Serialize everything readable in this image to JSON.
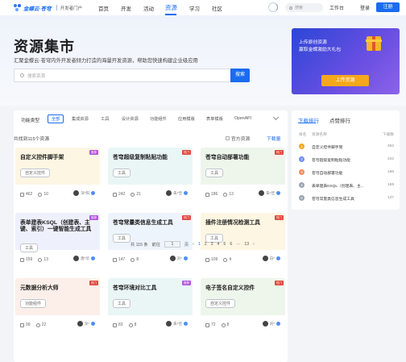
{
  "nav": {
    "logo_text": "金蝶云·苍穹",
    "logo_sub": "",
    "portal": "开发者门户",
    "items": [
      "首页",
      "开发",
      "活动",
      "资源",
      "学习",
      "社区"
    ],
    "search_placeholder": "搜索",
    "workbench": "工作台",
    "login": "登录",
    "register": "注册"
  },
  "hero": {
    "title": "资源集市",
    "subtitle": "汇聚金蝶云·苍穹内外开发者倾力打造的海量开发资源，帮助您快速构建企业级应用",
    "search_placeholder": "搜索资源",
    "search_button": "搜索"
  },
  "banner": {
    "line1": "上传原创资源",
    "line2": "赢取金蝶激励大礼包",
    "button": "上传资源"
  },
  "filter": {
    "label": "功能类型",
    "items": [
      "全部",
      "集成资源",
      "工具",
      "设计资源",
      "功能组件",
      "应用模版",
      "表单模版",
      "OpenAPI"
    ]
  },
  "list": {
    "total": "共找到115个资源",
    "official": "官方资源",
    "sort": "下载量"
  },
  "cards": [
    {
      "title": "自定义控件脚手架",
      "tag": "自定义控件",
      "likes": "462",
      "favs": "10",
      "author": "深*阳",
      "badge": "推荐",
      "badge_color": "#b555e0",
      "bg": "#fdf6e3"
    },
    {
      "title": "苍穹超级复制粘贴功能",
      "tag": "工具",
      "likes": "242",
      "favs": "21",
      "author": "朱*佳",
      "badge": "热门",
      "badge_color": "#e0483a",
      "bg": "#eaf6f6"
    },
    {
      "title": "苍穹自动部署功能",
      "tag": "工具",
      "likes": "186",
      "favs": "13",
      "author": "朱*佳",
      "badge": "热门",
      "badge_color": "#e0483a",
      "bg": "#eef6ec"
    },
    {
      "title": "表单建表KSQL（创建表、主键、索引）一键智能生成工具",
      "tag": "工具",
      "likes": "159",
      "favs": "13",
      "author": "唐*华",
      "badge": "推荐",
      "badge_color": "#b555e0",
      "bg": "#eef1fc"
    },
    {
      "title": "苍穹常量类信息生成工具",
      "tag": "工具",
      "likes": "147",
      "favs": "8",
      "author": "刘*",
      "badge": "热门",
      "badge_color": "#e0483a",
      "bg": "#eef4fb"
    },
    {
      "title": "插件注册情况检测工具",
      "tag": "工具",
      "likes": "109",
      "favs": "4",
      "author": "白*",
      "badge": "热门",
      "badge_color": "#e0483a",
      "bg": "#fdf6e3"
    },
    {
      "title": "元数据分析大师",
      "tag": "功能组件",
      "likes": "99",
      "favs": "22",
      "author": "深*",
      "badge": "热门",
      "badge_color": "#e0483a",
      "bg": "#fcefe9"
    },
    {
      "title": "苍穹环境对比工具",
      "tag": "工具",
      "likes": "83",
      "favs": "8",
      "author": "朱*佳",
      "badge": "推荐",
      "badge_color": "#b555e0",
      "bg": "#eaf6f6"
    },
    {
      "title": "电子签名自定义控件",
      "tag": "自定义控件",
      "likes": "72",
      "favs": "8",
      "author": "刘*",
      "badge": "热门",
      "badge_color": "#e0483a",
      "bg": "#eef6ec"
    }
  ],
  "pager": {
    "total": "共 115 条",
    "goto": "前往",
    "page_input": "1",
    "page_suffix": "页",
    "prev": "‹",
    "pages": [
      "1",
      "2",
      "3",
      "4",
      "5",
      "6"
    ],
    "ellipsis": "···",
    "last": "13",
    "next": "›"
  },
  "ranking": {
    "tabs": [
      "下载排行",
      "点赞排行"
    ],
    "head_rank": "排名",
    "head_name": "资源名称",
    "head_count": "下载数",
    "rows": [
      {
        "rank": "1",
        "name": "自定义控件脚手架",
        "count": "462",
        "color": "#f5a623"
      },
      {
        "rank": "2",
        "name": "苍穹超级复制粘贴功能",
        "count": "242",
        "color": "#6c8cf5"
      },
      {
        "rank": "3",
        "name": "苍穹自动部署功能",
        "count": "186",
        "color": "#f08c5a"
      },
      {
        "rank": "4",
        "name": "表单建表KSQL（创建表、主...",
        "count": "159",
        "color": "#9aa4b4"
      },
      {
        "rank": "5",
        "name": "苍穹常量类信息生成工具",
        "count": "147",
        "color": "#9aa4b4"
      }
    ]
  }
}
